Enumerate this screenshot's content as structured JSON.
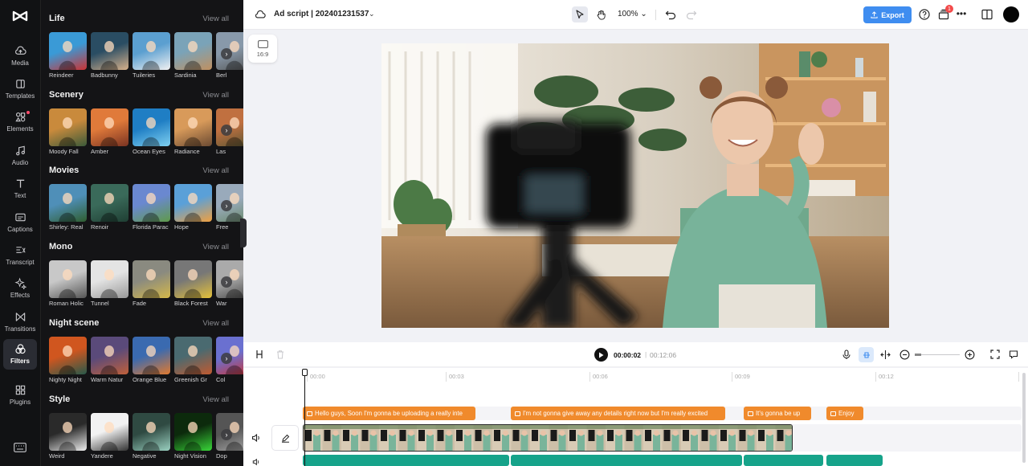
{
  "nav": {
    "items": [
      {
        "label": "Media",
        "icon": "cloud-upload-icon"
      },
      {
        "label": "Templates",
        "icon": "templates-icon"
      },
      {
        "label": "Elements",
        "icon": "elements-icon"
      },
      {
        "label": "Audio",
        "icon": "music-note-icon"
      },
      {
        "label": "Text",
        "icon": "text-icon"
      },
      {
        "label": "Captions",
        "icon": "captions-icon"
      },
      {
        "label": "Transcript",
        "icon": "transcript-icon"
      },
      {
        "label": "Effects",
        "icon": "sparkle-icon"
      },
      {
        "label": "Transitions",
        "icon": "transition-icon"
      },
      {
        "label": "Filters",
        "icon": "filters-icon"
      },
      {
        "label": "Plugins",
        "icon": "plugins-icon"
      }
    ],
    "active": "Filters"
  },
  "filters": {
    "view_all": "View all",
    "sections": [
      {
        "title": "Life",
        "items": [
          "Reindeer",
          "Badbunny",
          "Tuileries",
          "Sardinia",
          "Berl"
        ]
      },
      {
        "title": "Scenery",
        "items": [
          "Moody Fall",
          "Amber",
          "Ocean Eyes",
          "Radiance",
          "Las"
        ]
      },
      {
        "title": "Movies",
        "items": [
          "Shirley: Real",
          "Renoir",
          "Florida Parac",
          "Hope",
          "Free"
        ]
      },
      {
        "title": "Mono",
        "items": [
          "Roman Holic",
          "Tunnel",
          "Fade",
          "Black Forest",
          "War"
        ]
      },
      {
        "title": "Night scene",
        "items": [
          "Nighty Night",
          "Warm Natur",
          "Orange Blue",
          "Greenish Gr",
          "Col"
        ]
      },
      {
        "title": "Style",
        "items": [
          "Weird",
          "Yandere",
          "Negative",
          "Night Vision",
          "Dop"
        ]
      }
    ]
  },
  "topbar": {
    "project_title": "Ad script | 202401231537",
    "zoom": "100%",
    "export_label": "Export",
    "notification_count": "1"
  },
  "canvas": {
    "aspect_ratio": "16:9"
  },
  "timeline": {
    "current_time": "00:00:02",
    "separator": "|",
    "total_time": "00:12:06",
    "ruler": [
      "00:00",
      "00:03",
      "00:06",
      "00:09",
      "00:12"
    ],
    "captions": [
      "Hello guys, Soon I'm gonna be uploading a really inte",
      "I'm not gonna give away any details right now but I'm really excited",
      "It's gonna be up",
      "Enjoy"
    ]
  },
  "colors": {
    "accent": "#3f8df0",
    "caption_clip": "#f08a2c",
    "audio_clip": "#16a38a",
    "panel_bg": "#141416"
  }
}
